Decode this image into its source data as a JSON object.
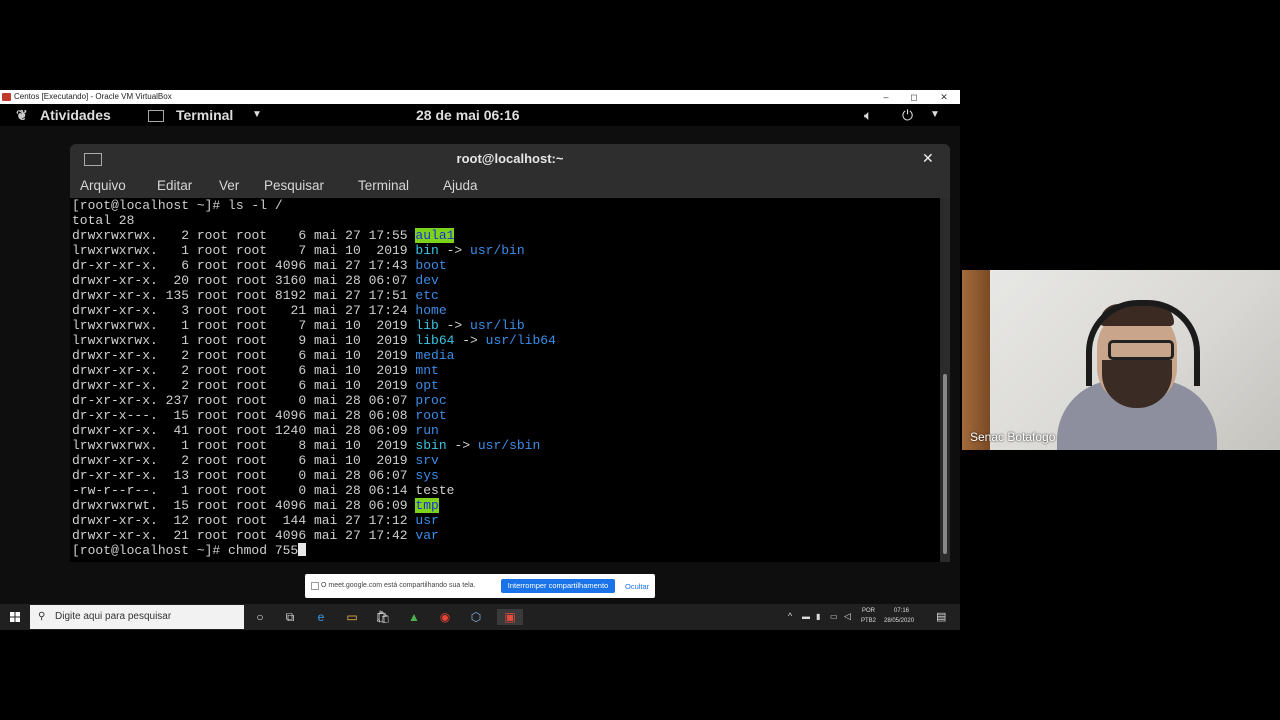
{
  "virtualbox": {
    "title": "Centos [Executando] - Oracle VM VirtualBox",
    "minimize": "–",
    "maximize": "◻",
    "close": "✕"
  },
  "gnome": {
    "activities": "Atividades",
    "app_menu": "Terminal",
    "clock": "28 de mai  06:16"
  },
  "terminal": {
    "title": "root@localhost:~",
    "menu": [
      "Arquivo",
      "Editar",
      "Ver",
      "Pesquisar",
      "Terminal",
      "Ajuda"
    ],
    "lines": [
      {
        "text": "[root@localhost ~]# ls -l /"
      },
      {
        "text": "total 28"
      },
      {
        "perm": "drwxrwxrwx.",
        "links": "2",
        "owner": "root",
        "group": "root",
        "size": "6",
        "month": "mai",
        "day": "27",
        "time": "17:55",
        "name": "aula1",
        "style": "hl"
      },
      {
        "perm": "lrwxrwxrwx.",
        "links": "1",
        "owner": "root",
        "group": "root",
        "size": "7",
        "month": "mai",
        "day": "10",
        "time": "2019",
        "name": "bin",
        "target": "usr/bin",
        "style": "cyan"
      },
      {
        "perm": "dr-xr-xr-x.",
        "links": "6",
        "owner": "root",
        "group": "root",
        "size": "4096",
        "month": "mai",
        "day": "27",
        "time": "17:43",
        "name": "boot",
        "style": "blue"
      },
      {
        "perm": "drwxr-xr-x.",
        "links": "20",
        "owner": "root",
        "group": "root",
        "size": "3160",
        "month": "mai",
        "day": "28",
        "time": "06:07",
        "name": "dev",
        "style": "blue"
      },
      {
        "perm": "drwxr-xr-x.",
        "links": "135",
        "owner": "root",
        "group": "root",
        "size": "8192",
        "month": "mai",
        "day": "27",
        "time": "17:51",
        "name": "etc",
        "style": "blue"
      },
      {
        "perm": "drwxr-xr-x.",
        "links": "3",
        "owner": "root",
        "group": "root",
        "size": "21",
        "month": "mai",
        "day": "27",
        "time": "17:24",
        "name": "home",
        "style": "blue"
      },
      {
        "perm": "lrwxrwxrwx.",
        "links": "1",
        "owner": "root",
        "group": "root",
        "size": "7",
        "month": "mai",
        "day": "10",
        "time": "2019",
        "name": "lib",
        "target": "usr/lib",
        "style": "cyan"
      },
      {
        "perm": "lrwxrwxrwx.",
        "links": "1",
        "owner": "root",
        "group": "root",
        "size": "9",
        "month": "mai",
        "day": "10",
        "time": "2019",
        "name": "lib64",
        "target": "usr/lib64",
        "style": "cyan"
      },
      {
        "perm": "drwxr-xr-x.",
        "links": "2",
        "owner": "root",
        "group": "root",
        "size": "6",
        "month": "mai",
        "day": "10",
        "time": "2019",
        "name": "media",
        "style": "blue"
      },
      {
        "perm": "drwxr-xr-x.",
        "links": "2",
        "owner": "root",
        "group": "root",
        "size": "6",
        "month": "mai",
        "day": "10",
        "time": "2019",
        "name": "mnt",
        "style": "blue"
      },
      {
        "perm": "drwxr-xr-x.",
        "links": "2",
        "owner": "root",
        "group": "root",
        "size": "6",
        "month": "mai",
        "day": "10",
        "time": "2019",
        "name": "opt",
        "style": "blue"
      },
      {
        "perm": "dr-xr-xr-x.",
        "links": "237",
        "owner": "root",
        "group": "root",
        "size": "0",
        "month": "mai",
        "day": "28",
        "time": "06:07",
        "name": "proc",
        "style": "blue"
      },
      {
        "perm": "dr-xr-x---.",
        "links": "15",
        "owner": "root",
        "group": "root",
        "size": "4096",
        "month": "mai",
        "day": "28",
        "time": "06:08",
        "name": "root",
        "style": "blue"
      },
      {
        "perm": "drwxr-xr-x.",
        "links": "41",
        "owner": "root",
        "group": "root",
        "size": "1240",
        "month": "mai",
        "day": "28",
        "time": "06:09",
        "name": "run",
        "style": "blue"
      },
      {
        "perm": "lrwxrwxrwx.",
        "links": "1",
        "owner": "root",
        "group": "root",
        "size": "8",
        "month": "mai",
        "day": "10",
        "time": "2019",
        "name": "sbin",
        "target": "usr/sbin",
        "style": "cyan"
      },
      {
        "perm": "drwxr-xr-x.",
        "links": "2",
        "owner": "root",
        "group": "root",
        "size": "6",
        "month": "mai",
        "day": "10",
        "time": "2019",
        "name": "srv",
        "style": "blue"
      },
      {
        "perm": "dr-xr-xr-x.",
        "links": "13",
        "owner": "root",
        "group": "root",
        "size": "0",
        "month": "mai",
        "day": "28",
        "time": "06:07",
        "name": "sys",
        "style": "blue"
      },
      {
        "perm": "-rw-r--r--.",
        "links": "1",
        "owner": "root",
        "group": "root",
        "size": "0",
        "month": "mai",
        "day": "28",
        "time": "06:14",
        "name": "teste",
        "style": "plain"
      },
      {
        "perm": "drwxrwxrwt.",
        "links": "15",
        "owner": "root",
        "group": "root",
        "size": "4096",
        "month": "mai",
        "day": "28",
        "time": "06:09",
        "name": "tmp",
        "style": "hl"
      },
      {
        "perm": "drwxr-xr-x.",
        "links": "12",
        "owner": "root",
        "group": "root",
        "size": "144",
        "month": "mai",
        "day": "27",
        "time": "17:12",
        "name": "usr",
        "style": "blue"
      },
      {
        "perm": "drwxr-xr-x.",
        "links": "21",
        "owner": "root",
        "group": "root",
        "size": "4096",
        "month": "mai",
        "day": "27",
        "time": "17:42",
        "name": "var",
        "style": "blue"
      }
    ],
    "prompt": "[root@localhost ~]# chmod 755"
  },
  "share_banner": {
    "text": "O meet.google.com está compartilhando sua tela.",
    "stop_label": "Interromper compartilhamento",
    "hide_label": "Ocultar"
  },
  "taskbar": {
    "search_placeholder": "Digite aqui para pesquisar",
    "lang_top": "POR",
    "lang_bottom": "PTB2",
    "time": "07:16",
    "date": "28/05/2020"
  },
  "video": {
    "participant_name": "Senac Botafogo"
  },
  "colors": {
    "dir": "#3b8ee8",
    "link": "#3cc4e6",
    "highlight_bg": "#7cd31a",
    "highlight_fg": "#1b2fd6",
    "meet_blue": "#1a73e8"
  }
}
